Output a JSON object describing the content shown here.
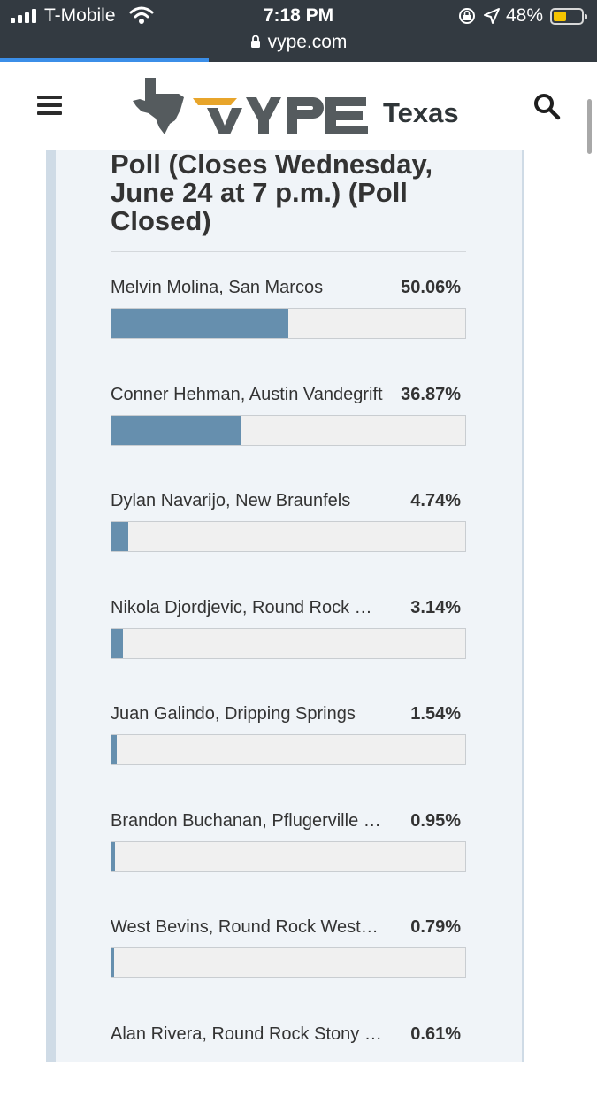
{
  "status_bar": {
    "carrier": "T-Mobile",
    "time": "7:18 PM",
    "battery_percent": "48%",
    "battery_level": 0.48
  },
  "browser": {
    "url": "vype.com",
    "load_progress": 0.35
  },
  "header": {
    "logo_text": "VYPE",
    "logo_region": "Texas"
  },
  "poll": {
    "title_lines": [
      "Poll (Closes Wednesday,",
      "June 24 at 7 p.m.) (Poll",
      "Closed)"
    ],
    "options": [
      {
        "name": "Melvin Molina, San Marcos",
        "percent": "50.06%",
        "value": 50.06
      },
      {
        "name": "Conner Hehman, Austin Vandegrift",
        "percent": "36.87%",
        "value": 36.87
      },
      {
        "name": "Dylan Navarijo, New Braunfels",
        "percent": "4.74%",
        "value": 4.74
      },
      {
        "name": "Nikola Djordjevic, Round Rock McNeil",
        "percent": "3.14%",
        "value": 3.14
      },
      {
        "name": "Juan Galindo, Dripping Springs",
        "percent": "1.54%",
        "value": 1.54
      },
      {
        "name": "Brandon Buchanan, Pflugerville Weiss",
        "percent": "0.95%",
        "value": 0.95
      },
      {
        "name": "West Bevins, Round Rock Westwood",
        "percent": "0.79%",
        "value": 0.79
      },
      {
        "name": "Alan Rivera, Round Rock Stony Point",
        "percent": "0.61%",
        "value": 0.61
      }
    ]
  },
  "colors": {
    "status_bar_bg": "#333a41",
    "bar_fill": "#668fae",
    "panel_bg": "#f0f4f8",
    "logo_accent": "#e8a52b"
  }
}
